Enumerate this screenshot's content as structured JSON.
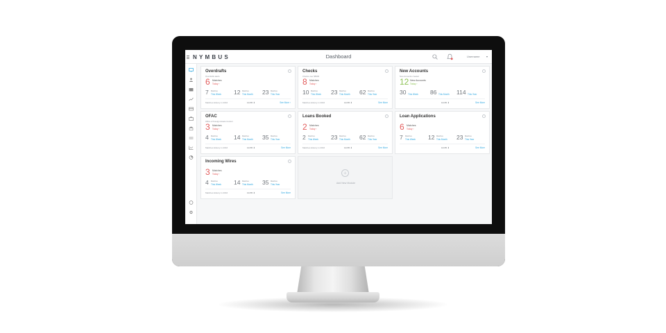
{
  "app": {
    "logo": "NYMBUS",
    "page_title": "Dashboard",
    "username": "Username",
    "caret": "▾"
  },
  "sidebar": {
    "icons": [
      "monitor-icon",
      "user-icon",
      "folder-icon",
      "chart-icon",
      "card-icon",
      "briefcase-icon",
      "bank-icon",
      "transfer-icon",
      "report-icon",
      "pie-icon",
      "help-icon",
      "settings-icon"
    ]
  },
  "cards": [
    {
      "title": "Overdrafts",
      "subtitle": "Overdrafts alerts",
      "big": "6",
      "big_label": "Matches",
      "big_sub": "Today ›",
      "stats": [
        {
          "n": "7",
          "label": "Matches",
          "period": "This Week"
        },
        {
          "n": "12",
          "label": "Matches",
          "period": "This Month"
        },
        {
          "n": "23",
          "label": "Matches",
          "period": "This Year"
        }
      ],
      "history": "Matches History in 2016",
      "history_value": "10x55 ⬇",
      "see_more": "See More ›"
    },
    {
      "title": "Checks",
      "subtitle": "Checks over $5000",
      "big": "8",
      "big_label": "Matches",
      "big_sub": "Today ›",
      "stats": [
        {
          "n": "10",
          "label": "Matches",
          "period": "This Week"
        },
        {
          "n": "23",
          "label": "Matches",
          "period": "This Month"
        },
        {
          "n": "62",
          "label": "Matches",
          "period": "This Year"
        }
      ],
      "history": "Matches History in 2016",
      "history_value": "10x55 ⬇",
      "see_more": "See More"
    },
    {
      "title": "New Accounts",
      "subtitle": "New Accounts created",
      "big": "12",
      "big_label": "New Accounts",
      "big_sub": "Today ›",
      "green": true,
      "stats": [
        {
          "n": "30",
          "label": "",
          "period": "This Week"
        },
        {
          "n": "86",
          "label": "",
          "period": "This Month"
        },
        {
          "n": "114",
          "label": "",
          "period": "This Year"
        }
      ],
      "history": "",
      "history_value": "10x55 ⬇",
      "see_more": "See More"
    },
    {
      "title": "OFAC",
      "subtitle": "Office of Foreign Assets Control",
      "big": "3",
      "big_label": "Matches",
      "big_sub": "Today ›",
      "stats": [
        {
          "n": "4",
          "label": "Matches",
          "period": "This Week"
        },
        {
          "n": "14",
          "label": "Matches",
          "period": "This Month"
        },
        {
          "n": "35",
          "label": "Matches",
          "period": "This Year"
        }
      ],
      "history": "Matches History in 2016",
      "history_value": "10x55 ⬇",
      "see_more": "See More"
    },
    {
      "title": "Loans Booked",
      "subtitle": "",
      "big": "2",
      "big_label": "Matches",
      "big_sub": "Today ›",
      "stats": [
        {
          "n": "2",
          "label": "Matches",
          "period": "This Week"
        },
        {
          "n": "23",
          "label": "Matches",
          "period": "This Month"
        },
        {
          "n": "62",
          "label": "Matches",
          "period": "This Year"
        }
      ],
      "history": "Matches History in 2016",
      "history_value": "10x55 ⬇",
      "see_more": "See More"
    },
    {
      "title": "Loan Applications",
      "subtitle": "",
      "big": "6",
      "big_label": "Matches",
      "big_sub": "Today ›",
      "stats": [
        {
          "n": "7",
          "label": "Matches",
          "period": "This Week"
        },
        {
          "n": "12",
          "label": "Matches",
          "period": "This Month"
        },
        {
          "n": "23",
          "label": "Matches",
          "period": "This Year"
        }
      ],
      "history": "",
      "history_value": "10x55 ⬇",
      "see_more": "See More"
    },
    {
      "title": "Incoming Wires",
      "subtitle": "",
      "big": "3",
      "big_label": "Matches",
      "big_sub": "Today ›",
      "stats": [
        {
          "n": "4",
          "label": "Matches",
          "period": "This Week"
        },
        {
          "n": "14",
          "label": "Matches",
          "period": "This Month"
        },
        {
          "n": "35",
          "label": "Matches",
          "period": "This Year"
        }
      ],
      "history": "Matches History in 2016",
      "history_value": "10x55 ⬇",
      "see_more": "See More"
    }
  ],
  "add_module": {
    "plus": "+",
    "label": "Add New Module"
  }
}
